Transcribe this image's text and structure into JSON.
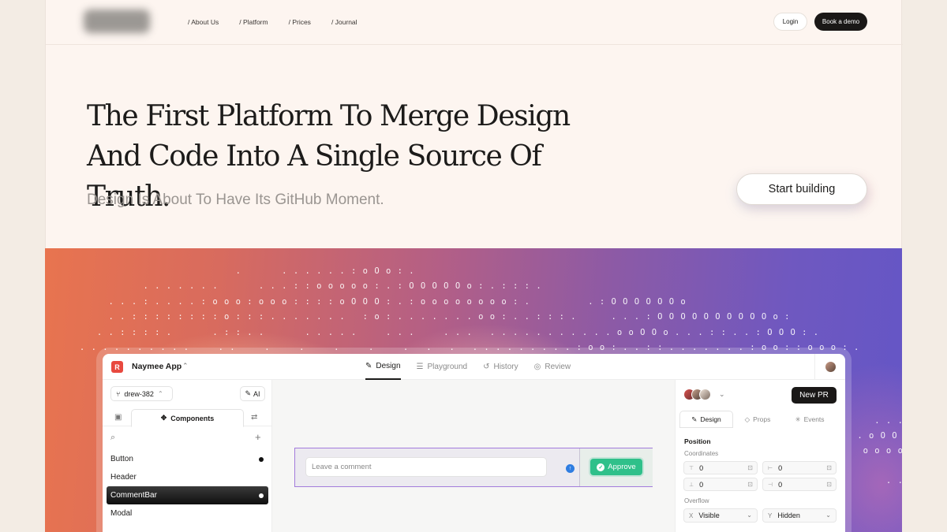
{
  "nav": {
    "links": [
      "/ About Us",
      "/ Platform",
      "/ Prices",
      "/ Journal"
    ],
    "login": "Login",
    "book_demo": "Book a demo"
  },
  "hero": {
    "title": "The First Platform To Merge Design And Code Into A Single Source Of Truth.",
    "subtitle": "Design Is About To Have Its GitHub Moment.",
    "cta": "Start building"
  },
  "art": {
    "ascii_lines": [
      "                                 .       . . . . . . : o O o : .",
      "                 . . . . . . .       . . . : : o o o o o : . : O O O O O o : . : : : .",
      "           . . . : . . . . : o o o : o o o : : : : o O O O : . : o o o o o o o o : .          . : O O O O O O o",
      "           . . : : : : : : : : o : : : . . . . . . .   : o : . . . . . . . o o : . . : : : .      . . . : O O O O O O O O O O o :",
      "         . . : : : : .       . : : . .       . . . . .     . . .     . . .   . . . . . . . . . . . o o O O o . . . : : . . : O O O : .",
      "      . . . . . . . . . .     . .     .     .     .     .     .   .   .   . . . . . . . . . : o o : . . : : . . . . . . . : o o : : o o o : ."
    ],
    "side_lines": [
      "    . . . .",
      " . o O O O o",
      "  o o o o O",
      "",
      "      . . ."
    ]
  },
  "app": {
    "name": "Naymee App",
    "logo_letter": "R",
    "tabs": [
      {
        "label": "Design",
        "icon": "design-icon"
      },
      {
        "label": "Playground",
        "icon": "playground-icon"
      },
      {
        "label": "History",
        "icon": "history-icon"
      },
      {
        "label": "Review",
        "icon": "review-icon"
      }
    ],
    "left": {
      "branch": "drew-382",
      "ai": "AI",
      "components_tab": "Components",
      "items": [
        {
          "label": "Button",
          "dot": true
        },
        {
          "label": "Header",
          "dot": false
        },
        {
          "label": "CommentBar",
          "dot": true
        },
        {
          "label": "Modal",
          "dot": false
        }
      ]
    },
    "canvas": {
      "comment_placeholder": "Leave a comment",
      "approve": "Approve"
    },
    "right": {
      "new_pr": "New PR",
      "tabs": [
        "Design",
        "Props",
        "Events"
      ],
      "position": "Position",
      "coordinates": "Coordinates",
      "coords": [
        "0",
        "0",
        "0",
        "0"
      ],
      "overflow": "Overflow",
      "overflow_x_axis": "X",
      "overflow_x": "Visible",
      "overflow_y_axis": "Y",
      "overflow_y": "Hidden"
    }
  },
  "colors": {
    "accent_dark": "#1a1817",
    "approve_green": "#2fc08a",
    "selection_purple": "#a37bdc",
    "brand_red": "#e8493f"
  }
}
